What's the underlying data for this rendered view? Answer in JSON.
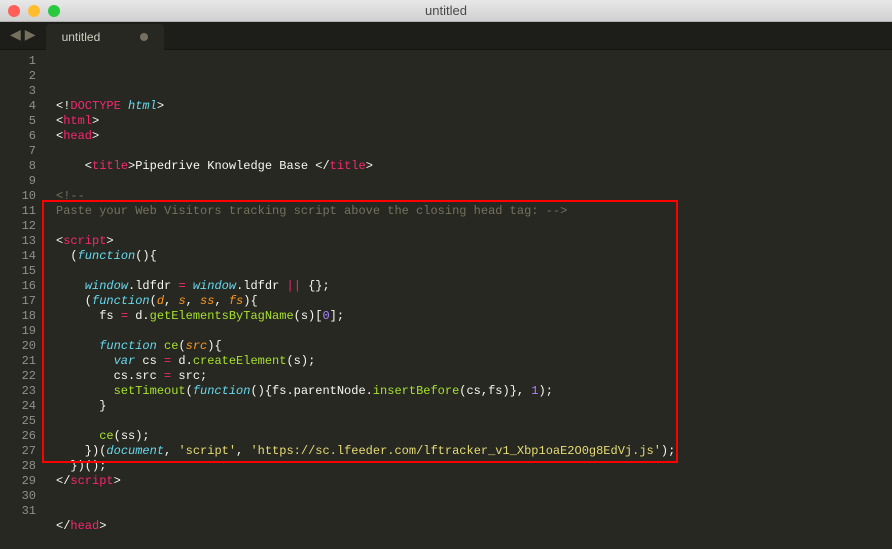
{
  "window": {
    "title": "untitled"
  },
  "tabs": {
    "active": {
      "label": "untitled"
    }
  },
  "highlight_box": {
    "line_start": 11,
    "line_end": 27
  },
  "gutter": {
    "start": 1,
    "end": 31
  },
  "code": {
    "lines": [
      {
        "tokens": [
          {
            "t": "<!",
            "c": "c-punct"
          },
          {
            "t": "DOCTYPE",
            "c": "c-tag"
          },
          {
            "t": " ",
            "c": "c-punct"
          },
          {
            "t": "html",
            "c": "c-entity"
          },
          {
            "t": ">",
            "c": "c-punct"
          }
        ]
      },
      {
        "tokens": [
          {
            "t": "<",
            "c": "c-punct"
          },
          {
            "t": "html",
            "c": "c-tag"
          },
          {
            "t": ">",
            "c": "c-punct"
          }
        ]
      },
      {
        "tokens": [
          {
            "t": "<",
            "c": "c-punct"
          },
          {
            "t": "head",
            "c": "c-tag"
          },
          {
            "t": ">",
            "c": "c-punct"
          }
        ]
      },
      {
        "tokens": []
      },
      {
        "tokens": [
          {
            "t": "    <",
            "c": "c-punct"
          },
          {
            "t": "title",
            "c": "c-tag"
          },
          {
            "t": ">",
            "c": "c-punct"
          },
          {
            "t": "Pipedrive Knowledge Base ",
            "c": "c-punct"
          },
          {
            "t": "</",
            "c": "c-punct"
          },
          {
            "t": "title",
            "c": "c-tag"
          },
          {
            "t": ">",
            "c": "c-punct"
          }
        ]
      },
      {
        "tokens": []
      },
      {
        "tokens": [
          {
            "t": "<!--",
            "c": "c-comment"
          }
        ]
      },
      {
        "tokens": [
          {
            "t": "Paste your Web Visitors tracking script above the closing head tag: -->",
            "c": "c-comment"
          }
        ]
      },
      {
        "tokens": []
      },
      {
        "tokens": [
          {
            "t": "<",
            "c": "c-punct"
          },
          {
            "t": "script",
            "c": "c-tag"
          },
          {
            "t": ">",
            "c": "c-punct"
          }
        ]
      },
      {
        "tokens": [
          {
            "t": "  (",
            "c": "c-punct"
          },
          {
            "t": "function",
            "c": "c-keyword"
          },
          {
            "t": "(){",
            "c": "c-punct"
          }
        ]
      },
      {
        "tokens": []
      },
      {
        "tokens": [
          {
            "t": "    ",
            "c": "c-punct"
          },
          {
            "t": "window",
            "c": "c-keyword"
          },
          {
            "t": ".",
            "c": "c-punct"
          },
          {
            "t": "ldfdr",
            "c": "c-varcall"
          },
          {
            "t": " ",
            "c": "c-punct"
          },
          {
            "t": "=",
            "c": "c-op"
          },
          {
            "t": " ",
            "c": "c-punct"
          },
          {
            "t": "window",
            "c": "c-keyword"
          },
          {
            "t": ".",
            "c": "c-punct"
          },
          {
            "t": "ldfdr",
            "c": "c-varcall"
          },
          {
            "t": " ",
            "c": "c-punct"
          },
          {
            "t": "||",
            "c": "c-op"
          },
          {
            "t": " {};",
            "c": "c-punct"
          }
        ]
      },
      {
        "tokens": [
          {
            "t": "    (",
            "c": "c-punct"
          },
          {
            "t": "function",
            "c": "c-keyword"
          },
          {
            "t": "(",
            "c": "c-punct"
          },
          {
            "t": "d",
            "c": "c-var"
          },
          {
            "t": ", ",
            "c": "c-punct"
          },
          {
            "t": "s",
            "c": "c-var"
          },
          {
            "t": ", ",
            "c": "c-punct"
          },
          {
            "t": "ss",
            "c": "c-var"
          },
          {
            "t": ", ",
            "c": "c-punct"
          },
          {
            "t": "fs",
            "c": "c-var"
          },
          {
            "t": "){",
            "c": "c-punct"
          }
        ]
      },
      {
        "tokens": [
          {
            "t": "      fs ",
            "c": "c-punct"
          },
          {
            "t": "=",
            "c": "c-op"
          },
          {
            "t": " d.",
            "c": "c-punct"
          },
          {
            "t": "getElementsByTagName",
            "c": "c-func"
          },
          {
            "t": "(s)[",
            "c": "c-punct"
          },
          {
            "t": "0",
            "c": "c-num"
          },
          {
            "t": "];",
            "c": "c-punct"
          }
        ]
      },
      {
        "tokens": []
      },
      {
        "tokens": [
          {
            "t": "      ",
            "c": "c-punct"
          },
          {
            "t": "function",
            "c": "c-keyword"
          },
          {
            "t": " ",
            "c": "c-punct"
          },
          {
            "t": "ce",
            "c": "c-funcdef"
          },
          {
            "t": "(",
            "c": "c-punct"
          },
          {
            "t": "src",
            "c": "c-var"
          },
          {
            "t": "){",
            "c": "c-punct"
          }
        ]
      },
      {
        "tokens": [
          {
            "t": "        ",
            "c": "c-punct"
          },
          {
            "t": "var",
            "c": "c-keyword"
          },
          {
            "t": " cs ",
            "c": "c-punct"
          },
          {
            "t": "=",
            "c": "c-op"
          },
          {
            "t": " d.",
            "c": "c-punct"
          },
          {
            "t": "createElement",
            "c": "c-func"
          },
          {
            "t": "(s);",
            "c": "c-punct"
          }
        ]
      },
      {
        "tokens": [
          {
            "t": "        cs.src ",
            "c": "c-punct"
          },
          {
            "t": "=",
            "c": "c-op"
          },
          {
            "t": " src;",
            "c": "c-punct"
          }
        ]
      },
      {
        "tokens": [
          {
            "t": "        ",
            "c": "c-punct"
          },
          {
            "t": "setTimeout",
            "c": "c-func"
          },
          {
            "t": "(",
            "c": "c-punct"
          },
          {
            "t": "function",
            "c": "c-keyword"
          },
          {
            "t": "(){fs.parentNode.",
            "c": "c-punct"
          },
          {
            "t": "insertBefore",
            "c": "c-func"
          },
          {
            "t": "(cs,fs)}, ",
            "c": "c-punct"
          },
          {
            "t": "1",
            "c": "c-num"
          },
          {
            "t": ");",
            "c": "c-punct"
          }
        ]
      },
      {
        "tokens": [
          {
            "t": "      }",
            "c": "c-punct"
          }
        ]
      },
      {
        "tokens": []
      },
      {
        "tokens": [
          {
            "t": "      ",
            "c": "c-punct"
          },
          {
            "t": "ce",
            "c": "c-func"
          },
          {
            "t": "(ss);",
            "c": "c-punct"
          }
        ]
      },
      {
        "tokens": [
          {
            "t": "    })(",
            "c": "c-punct"
          },
          {
            "t": "document",
            "c": "c-keyword"
          },
          {
            "t": ", ",
            "c": "c-punct"
          },
          {
            "t": "'script'",
            "c": "c-string"
          },
          {
            "t": ", ",
            "c": "c-punct"
          },
          {
            "t": "'https://sc.lfeeder.com/lftracker_v1_Xbp1oaE2O0g8EdVj.js'",
            "c": "c-string"
          },
          {
            "t": ");",
            "c": "c-punct"
          }
        ]
      },
      {
        "tokens": [
          {
            "t": "  })();",
            "c": "c-punct"
          }
        ]
      },
      {
        "tokens": [
          {
            "t": "</",
            "c": "c-punct"
          },
          {
            "t": "script",
            "c": "c-tag"
          },
          {
            "t": ">",
            "c": "c-punct"
          }
        ]
      },
      {
        "tokens": []
      },
      {
        "tokens": []
      },
      {
        "tokens": [
          {
            "t": "</",
            "c": "c-punct"
          },
          {
            "t": "head",
            "c": "c-tag"
          },
          {
            "t": ">",
            "c": "c-punct"
          }
        ]
      },
      {
        "tokens": []
      }
    ]
  }
}
